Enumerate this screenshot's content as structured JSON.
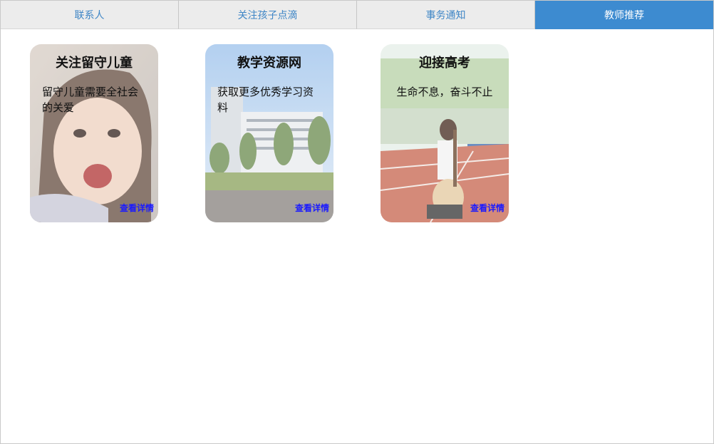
{
  "tabs": [
    {
      "label": "联系人"
    },
    {
      "label": "关注孩子点滴"
    },
    {
      "label": "事务通知"
    },
    {
      "label": "教师推荐"
    }
  ],
  "active_tab": "教师推荐",
  "cards": [
    {
      "title": "关注留守儿童",
      "desc": "留守儿童需要全社会的关爱",
      "link": "查看详情",
      "image": "smiling-girl-photo"
    },
    {
      "title": "教学资源网",
      "desc": "获取更多优秀学习资料",
      "link": "查看详情",
      "image": "campus-building-photo"
    },
    {
      "title": "迎接高考",
      "desc": "生命不息，奋斗不止",
      "link": "查看详情",
      "image": "girl-with-guitar-on-track-photo"
    }
  ],
  "colors": {
    "tab_bg": "#ececec",
    "tab_text": "#3f86c6",
    "active_bg": "#3d8bd0",
    "link": "#1a1aff"
  }
}
